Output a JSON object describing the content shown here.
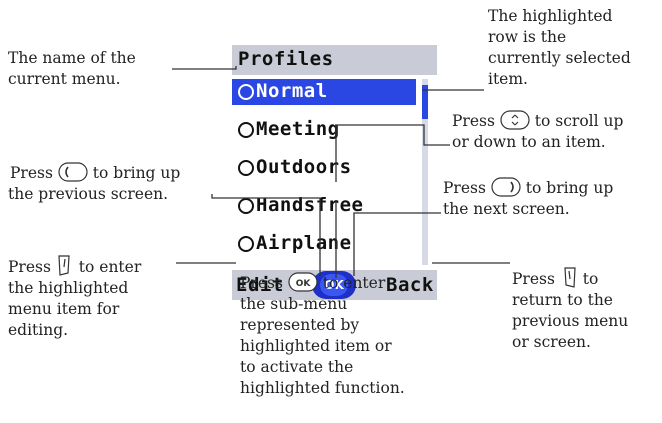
{
  "screen": {
    "title": "Profiles",
    "items": [
      {
        "label": "Normal",
        "selected": true
      },
      {
        "label": "Meeting",
        "selected": false
      },
      {
        "label": "Outdoors",
        "selected": false
      },
      {
        "label": "Handsfree",
        "selected": false
      },
      {
        "label": "Airplane",
        "selected": false
      }
    ],
    "softkeys": {
      "left": "Edit",
      "center": "OK",
      "right": "Back"
    }
  },
  "annotations": {
    "menu_name": [
      "The name of the",
      "current menu."
    ],
    "highlighted_row": [
      "The highlighted",
      "row is the",
      "currently selected",
      "item."
    ],
    "scroll": {
      "line1_pre": "Press ",
      "line1_post": " to scroll up",
      "line2": "or down to an item."
    },
    "previous_screen": {
      "line1_pre": "Press ",
      "line1_post": " to bring up",
      "line2": "the previous screen."
    },
    "next_screen": {
      "line1_pre": "Press ",
      "line1_post": " to bring up",
      "line2": "the next screen."
    },
    "left_softkey": {
      "line1_pre": "Press ",
      "line1_post": " to enter",
      "rest": [
        "the highlighted",
        "menu item for",
        "editing."
      ]
    },
    "right_softkey": {
      "line1_pre": "Press ",
      "line1_post": " to",
      "rest": [
        "return to the",
        "previous menu",
        "or screen."
      ]
    },
    "ok_key": {
      "line1_pre": "Press ",
      "line1_post": " to enter",
      "rest": [
        "the sub-menu",
        "represented by",
        "highlighted item or",
        "to activate the",
        "highlighted function."
      ]
    }
  },
  "icons": {
    "nav_up_down": "nav-up-down-icon",
    "nav_left": "nav-left-icon",
    "nav_right": "nav-right-icon",
    "left_softkey": "left-softkey-icon",
    "right_softkey": "right-softkey-icon",
    "ok_key": "ok-key-icon"
  },
  "colors": {
    "screen_blue": "#2a3bd8",
    "highlight_blue": "#2b47e3",
    "bar_gray": "#c9ccd6"
  }
}
